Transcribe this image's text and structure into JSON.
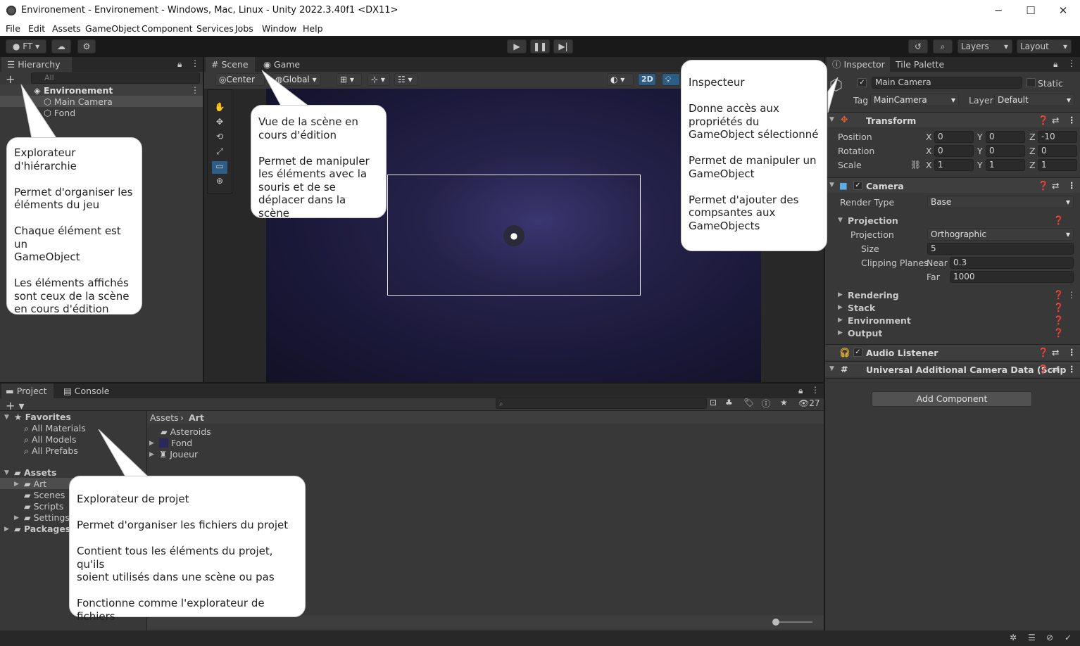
{
  "window": {
    "title": "Environement - Environement - Windows, Mac, Linux - Unity 2022.3.40f1 <DX11>",
    "min": "─",
    "max": "☐",
    "close": "✕"
  },
  "menu": [
    "File",
    "Edit",
    "Assets",
    "GameObject",
    "Component",
    "Services",
    "Jobs",
    "Window",
    "Help"
  ],
  "toolbar": {
    "account": "FT",
    "layers": "Layers",
    "layout": "Layout"
  },
  "hierarchy": {
    "tab": "Hierarchy",
    "search_placeholder": "All",
    "scene": "Environement",
    "items": [
      "Main Camera",
      "Fond"
    ]
  },
  "scene": {
    "tab_scene": "Scene",
    "tab_game": "Game",
    "pivot": "Center",
    "space": "Global",
    "mode2d": "2D"
  },
  "inspector": {
    "tab": "Inspector",
    "tab2": "Tile Palette",
    "name": "Main Camera",
    "static": "Static",
    "tag_label": "Tag",
    "tag": "MainCamera",
    "layer_label": "Layer",
    "layer": "Default",
    "transform": {
      "title": "Transform",
      "position": "Position",
      "rotation": "Rotation",
      "scale": "Scale",
      "pos": [
        "0",
        "0",
        "-10"
      ],
      "rot": [
        "0",
        "0",
        "0"
      ],
      "scl": [
        "1",
        "1",
        "1"
      ]
    },
    "camera": {
      "title": "Camera",
      "render_type_label": "Render Type",
      "render_type": "Base",
      "projection_section": "Projection",
      "projection_label": "Projection",
      "projection": "Orthographic",
      "size_label": "Size",
      "size": "5",
      "clipping_label": "Clipping Planes",
      "near_label": "Near",
      "near": "0.3",
      "far_label": "Far",
      "far": "1000",
      "rendering": "Rendering",
      "stack": "Stack",
      "environment": "Environment",
      "output": "Output"
    },
    "audio": "Audio Listener",
    "urp": "Universal Additional Camera Data (Scrip",
    "add_component": "Add Component"
  },
  "project": {
    "tab": "Project",
    "tab2": "Console",
    "count": "27",
    "favorites": "Favorites",
    "fav_items": [
      "All Materials",
      "All Models",
      "All Prefabs"
    ],
    "assets": "Assets",
    "asset_folders": [
      "Art",
      "Scenes",
      "Scripts",
      "Settings"
    ],
    "packages": "Packages",
    "breadcrumb_root": "Assets",
    "breadcrumb_leaf": "Art",
    "files": [
      "Asteroids",
      "Fond",
      "Joueur"
    ]
  },
  "bubbles": {
    "hierarchy": "Explorateur\nd'hiérarchie|Permet d'organiser les\néléments du jeu|Chaque élément est un\nGameObject|Les éléments affichés\nsont ceux de la scène\nen cours d'édition",
    "scene": "Vue de la scène en\ncours d'édition|Permet de manipuler\nles éléments avec la\nsouris et de se\ndéplacer dans la scène",
    "inspector": "Inspecteur|Donne accès aux\npropriétés du\nGameObject sélectionné|Permet de manipuler un\nGameObject|Permet d'ajouter des\ncompsantes aux\nGameObjects",
    "project": "Explorateur de projet|Permet d'organiser les fichiers du projet|Contient tous les éléments du projet, qu'ils\nsoient utilisés dans une scène ou pas|Fonctionne comme l'explorateur de fichiers"
  },
  "colors": {
    "accent": "#2c5d87",
    "selection": "#4d4d4d",
    "scene_bg": "#1a1838"
  }
}
